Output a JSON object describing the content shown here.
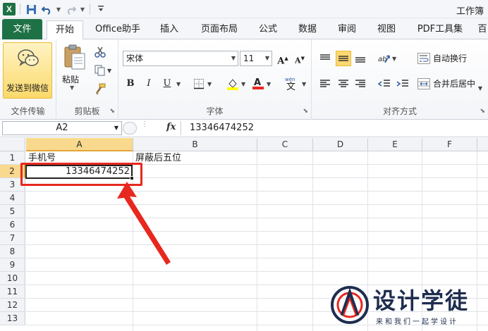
{
  "window": {
    "title": "工作簿"
  },
  "tabs": [
    {
      "label": "文件",
      "kind": "file"
    },
    {
      "label": "开始",
      "kind": "active"
    },
    {
      "label": "Office助手"
    },
    {
      "label": "插入"
    },
    {
      "label": "页面布局"
    },
    {
      "label": "公式"
    },
    {
      "label": "数据"
    },
    {
      "label": "审阅"
    },
    {
      "label": "视图"
    },
    {
      "label": "PDF工具集"
    },
    {
      "label": "百"
    }
  ],
  "ribbon": {
    "wechat": {
      "button_label": "发送到微信",
      "group_label": "文件传输"
    },
    "clipboard": {
      "paste_label": "粘贴",
      "group_label": "剪贴板"
    },
    "font": {
      "name": "宋体",
      "size": "11",
      "bold": "B",
      "italic": "I",
      "underline": "U",
      "group_label": "字体",
      "phonetic": "wén"
    },
    "alignment": {
      "wrap_label": "自动换行",
      "merge_label": "合并后居中",
      "group_label": "对齐方式"
    }
  },
  "formula_bar": {
    "name_box": "A2",
    "fx": "fx",
    "content": "13346474252"
  },
  "grid": {
    "columns": [
      "A",
      "B",
      "C",
      "D",
      "E",
      "F"
    ],
    "rows": [
      "1",
      "2",
      "3",
      "4",
      "5",
      "6",
      "7",
      "8",
      "9",
      "10",
      "11",
      "12",
      "13"
    ],
    "selected_column": "A",
    "selected_row": "2",
    "cells": {
      "A1": "手机号",
      "B1": "屏蔽后五位",
      "A2": "13346474252"
    }
  },
  "watermark": {
    "title": "设计学徒",
    "subtitle": "来和我们一起学设计"
  },
  "colors": {
    "excel_green": "#1e7145",
    "selection": "#f9d98d",
    "annotation_red": "#e8281e",
    "watermark": "#1e2d4f"
  }
}
